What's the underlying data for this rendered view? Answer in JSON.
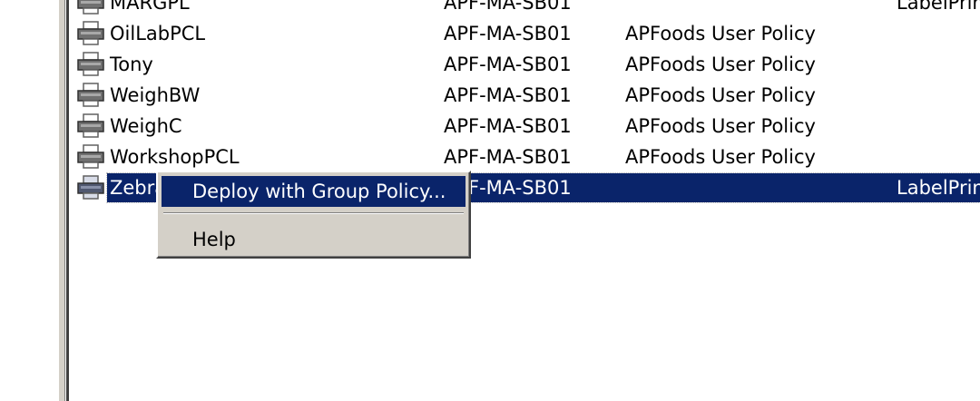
{
  "rows": [
    {
      "name": "MARGPL",
      "server": "APF-MA-SB01",
      "policy": "",
      "driver": "LabelPrint"
    },
    {
      "name": "OilLabPCL",
      "server": "APF-MA-SB01",
      "policy": "APFoods User Policy",
      "driver": ""
    },
    {
      "name": "Tony",
      "server": "APF-MA-SB01",
      "policy": "APFoods User Policy",
      "driver": ""
    },
    {
      "name": "WeighBW",
      "server": "APF-MA-SB01",
      "policy": "APFoods User Policy",
      "driver": ""
    },
    {
      "name": "WeighC",
      "server": "APF-MA-SB01",
      "policy": "APFoods User Policy",
      "driver": ""
    },
    {
      "name": "WorkshopPCL",
      "server": "APF-MA-SB01",
      "policy": "APFoods User Policy",
      "driver": ""
    },
    {
      "name": "Zebra",
      "server": "APF-MA-SB01",
      "policy": "",
      "driver": "LabelPrint"
    }
  ],
  "selected_row": "Zebra",
  "context_menu": {
    "deploy": "Deploy with Group Policy...",
    "help": "Help"
  },
  "icons": {
    "row_icon": "printer-icon"
  },
  "colors": {
    "selection": "#0a246a",
    "menu_bg": "#d4d0c8"
  }
}
